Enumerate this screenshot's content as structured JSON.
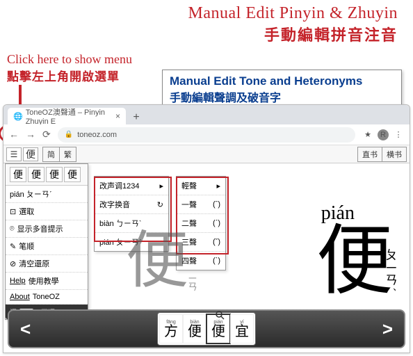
{
  "title": {
    "en": "Manual Edit Pinyin & Zhuyin",
    "zh": "手動編輯拼音注音"
  },
  "hint": {
    "en": "Click here to show menu",
    "zh": "點擊左上角開啟選單"
  },
  "callout": {
    "en": "Manual Edit Tone and Heteronyms",
    "zh": "手動編輯聲調及破音字"
  },
  "browser": {
    "tab_title": "ToneOZ澳聲通 – Pinyin Zhuyin E",
    "url": "toneoz.com",
    "newtab": "+",
    "nav": {
      "back": "←",
      "fwd": "→",
      "reload": "⟳"
    },
    "chrome": {
      "ext": "★",
      "avatar": "R",
      "menu": "⋮"
    }
  },
  "toolbar": {
    "menu_char": "便",
    "simptr": [
      "简",
      "繁"
    ],
    "orientation": [
      "直书",
      "横书"
    ]
  },
  "sidemenu": {
    "chars": [
      "便",
      "便",
      "便",
      "便"
    ],
    "pinyin_row": "pián ㄆㄧㄢˊ",
    "items": [
      {
        "icon": "⊡",
        "label": "選取"
      },
      {
        "icon": "⌾",
        "label": "显示多音提示"
      },
      {
        "icon": "✎",
        "label": "笔顺"
      },
      {
        "icon": "⊘",
        "label": "清空還原"
      },
      {
        "icon": "Help",
        "label": "使用教學"
      },
      {
        "icon": "About",
        "label": "ToneOZ"
      }
    ],
    "status": {
      "prefix": "闲",
      "badge": "ON",
      "suffix": "^ 国语"
    }
  },
  "submenu1": {
    "rows": [
      {
        "label": "改声调1234",
        "icon": "▸"
      },
      {
        "label": "改字换音",
        "icon": "↻"
      },
      {
        "label": "biàn ㄅㄧㄢˋ",
        "icon": ""
      },
      {
        "label": "pián ㄆㄧㄢˊ",
        "icon": ""
      }
    ]
  },
  "submenu2": {
    "rows": [
      {
        "label": "輕聲",
        "mark": "▸"
      },
      {
        "label": "一聲",
        "mark": "(ˉ)"
      },
      {
        "label": "二聲",
        "mark": "(ˊ)"
      },
      {
        "label": "三聲",
        "mark": "(ˇ)"
      },
      {
        "label": "四聲",
        "mark": "(ˋ)"
      }
    ]
  },
  "big": {
    "pinyin": "pián",
    "char": "便",
    "zhuyin": "ㄆㄧㄢˊ"
  },
  "mid": {
    "char": "便",
    "zhuyin": "ㄧㄢ"
  },
  "candidates": [
    {
      "py": "fāng",
      "ch": "方"
    },
    {
      "py": "biàn",
      "ch": "便"
    },
    {
      "py": "pián",
      "ch": "便",
      "selected": true
    },
    {
      "py": "yí",
      "ch": "宜"
    }
  ],
  "bottombar": {
    "left": "<",
    "right": ">"
  }
}
